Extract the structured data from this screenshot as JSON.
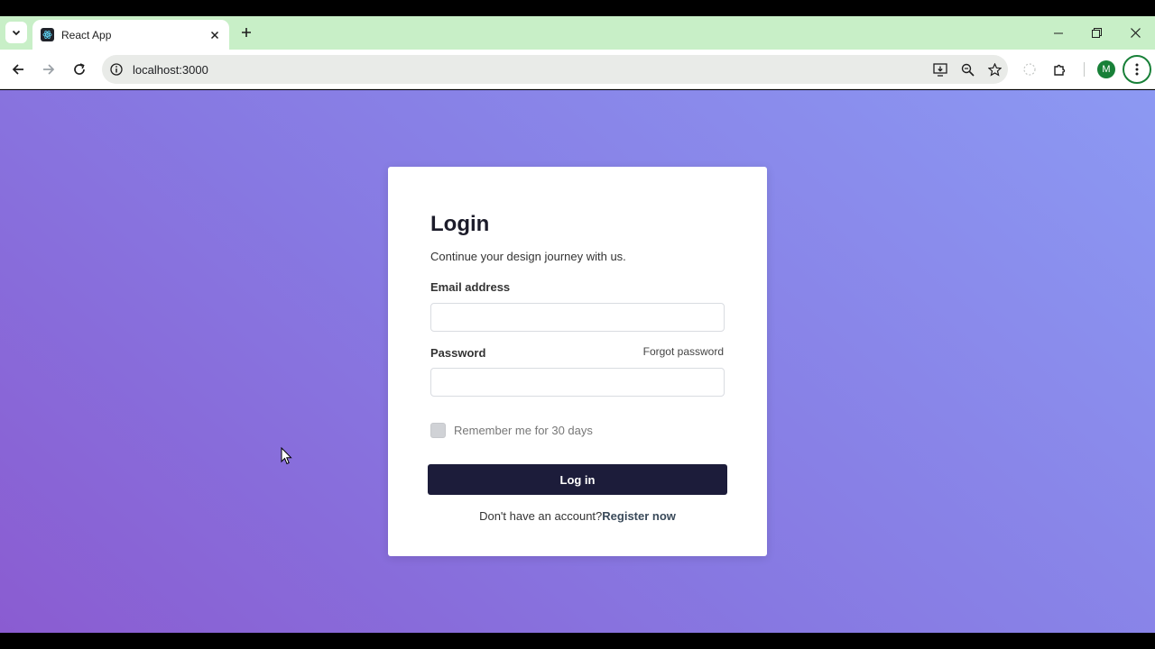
{
  "browser": {
    "tab": {
      "title": "React App",
      "favicon": "react-favicon"
    },
    "url": "localhost:3000",
    "profile_initial": "M",
    "colors": {
      "tab_strip": "#c8efc7",
      "omnibox": "#e9ebe8",
      "profile": "#188038"
    }
  },
  "login": {
    "title": "Login",
    "subtitle": "Continue your design journey with us.",
    "email_label": "Email address",
    "password_label": "Password",
    "forgot_password": "Forgot password",
    "remember_label": "Remember me for 30 days",
    "submit_label": "Log in",
    "register_prompt": "Don't have an account?",
    "register_link": "Register now"
  },
  "colors": {
    "button": "#1c1c3a",
    "background_start": "#8a5cd1",
    "background_end": "#8c99f3"
  }
}
